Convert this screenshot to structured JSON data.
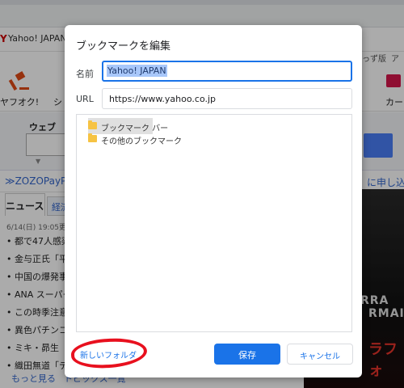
{
  "background": {
    "tab_title": "Yahoo! JAPAN",
    "top_links": [
      "っず版",
      "ア"
    ],
    "services": {
      "auction_label": "ヤフオク!",
      "shopping_label": "シ",
      "card_label": "カー"
    },
    "search": {
      "tab_label": "ウェブ"
    },
    "promo": {
      "left_text": "≫ZOZOPayPa",
      "right_text": "に申し込み"
    },
    "news": {
      "active_tab": "ニュース",
      "other_tab": "経済",
      "date": "6/14(日) 19:05更新",
      "items": [
        "• 都で47人感染",
        "• 金与正氏「平",
        "• 中国の爆発事",
        "• ANA スーパー",
        "• この時季注意",
        "• 異色パチンコ",
        "• ミキ・昴生「",
        "• 織田無道「テ"
      ],
      "more_links": [
        "もっと見る",
        "トピックス一覧"
      ]
    },
    "ad": {
      "line1": "RRA",
      "line2": "RMAI",
      "line3": "ラフォ"
    }
  },
  "dialog": {
    "title": "ブックマークを編集",
    "name_label": "名前",
    "name_value": "Yahoo! JAPAN",
    "url_label": "URL",
    "url_value": "https://www.yahoo.co.jp",
    "folders": [
      {
        "label": "ブックマーク バー",
        "selected": true
      },
      {
        "label": "その他のブックマーク",
        "selected": false
      }
    ],
    "new_folder_label": "新しいフォルダ",
    "save_label": "保存",
    "cancel_label": "キャンセル"
  }
}
